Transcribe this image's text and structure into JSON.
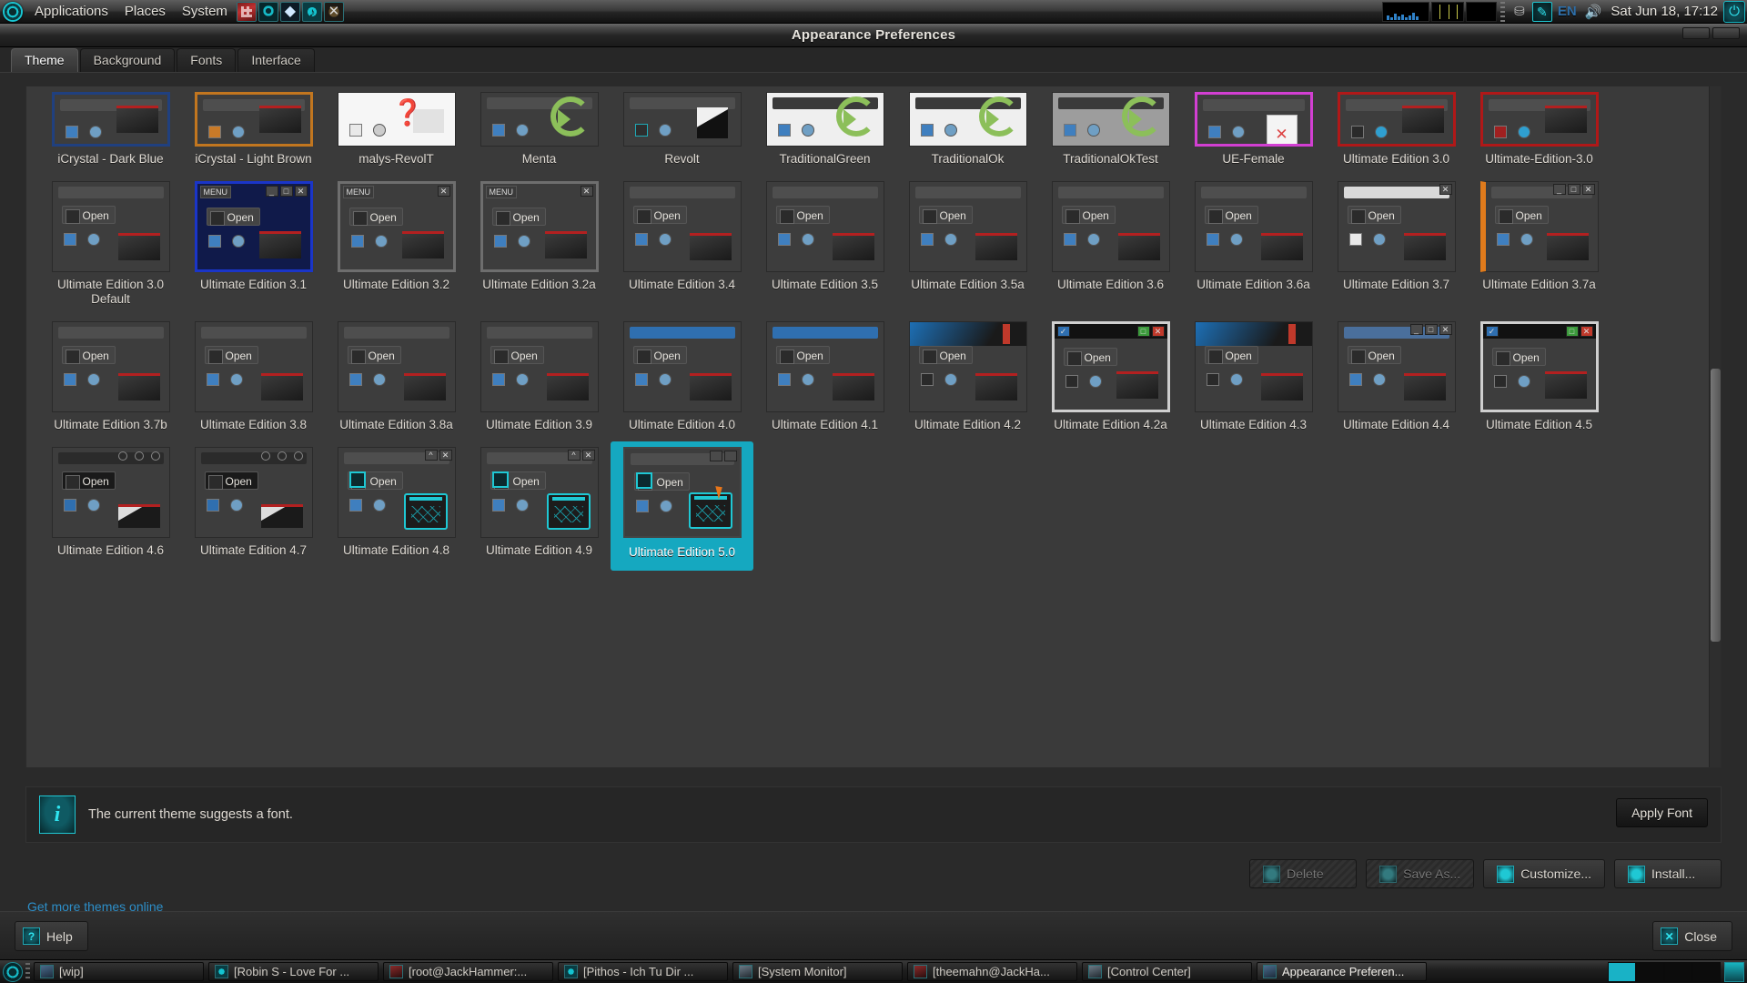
{
  "top_panel": {
    "logo_icon": "gnome-foot-icon",
    "menus": [
      "Applications",
      "Places",
      "System"
    ],
    "launchers": [
      {
        "name": "keyboard-shortcuts-icon"
      },
      {
        "name": "ultimate-edition-icon"
      },
      {
        "name": "kodi-icon"
      },
      {
        "name": "music-player-icon"
      },
      {
        "name": "xterm-icon"
      }
    ],
    "tray": {
      "monitor_icon": "system-monitor-applet",
      "drive_icon": "disk-activity-icon",
      "pen_icon": "screenshot-pen-icon",
      "language": "EN",
      "volume_icon": "volume-icon",
      "clock": "Sat Jun 18, 17:12",
      "power_icon": "power-button-icon"
    }
  },
  "window": {
    "title": "Appearance Preferences",
    "tabs": [
      {
        "label": "Theme",
        "active": true
      },
      {
        "label": "Background",
        "active": false
      },
      {
        "label": "Fonts",
        "active": false
      },
      {
        "label": "Interface",
        "active": false
      }
    ]
  },
  "themes": {
    "rows": [
      [
        {
          "label": "iCrystal - Dark Blue",
          "style": "icrystal-blue",
          "clipped": true
        },
        {
          "label": "iCrystal - Light Brown",
          "style": "icrystal-brown",
          "clipped": true
        },
        {
          "label": "malys-RevolT",
          "style": "light-doc",
          "clipped": true
        },
        {
          "label": "Menta",
          "style": "dark-circle",
          "clipped": true
        },
        {
          "label": "Revolt",
          "style": "dark-folder",
          "clipped": true
        },
        {
          "label": "TraditionalGreen",
          "style": "light-circle",
          "clipped": true
        },
        {
          "label": "TraditionalOk",
          "style": "light-circle",
          "clipped": true
        },
        {
          "label": "TraditionalOkTest",
          "style": "grey-circle",
          "clipped": true
        },
        {
          "label": "UE-Female",
          "style": "magenta-doc",
          "clipped": true
        },
        {
          "label": "Ultimate Edition 3.0",
          "style": "red-folder",
          "clipped": true
        },
        {
          "label": "Ultimate-Edition-3.0",
          "style": "red-folder2",
          "clipped": true
        }
      ],
      [
        {
          "label": "Ultimate Edition 3.0 Default",
          "style": "plain-dark"
        },
        {
          "label": "Ultimate Edition 3.1",
          "style": "blue-glow"
        },
        {
          "label": "Ultimate Edition 3.2",
          "style": "menu-dark"
        },
        {
          "label": "Ultimate Edition 3.2a",
          "style": "menu-dark2"
        },
        {
          "label": "Ultimate Edition 3.4",
          "style": "plain-dark"
        },
        {
          "label": "Ultimate Edition 3.5",
          "style": "plain-dark"
        },
        {
          "label": "Ultimate Edition 3.5a",
          "style": "plain-dark"
        },
        {
          "label": "Ultimate Edition 3.6",
          "style": "plain-dark"
        },
        {
          "label": "Ultimate Edition 3.6a",
          "style": "plain-dark"
        },
        {
          "label": "Ultimate Edition 3.7",
          "style": "grey-bar"
        },
        {
          "label": "Ultimate Edition 3.7a",
          "style": "orange-edge"
        }
      ],
      [
        {
          "label": "Ultimate Edition 3.7b",
          "style": "plain-dark"
        },
        {
          "label": "Ultimate Edition 3.8",
          "style": "plain-dark"
        },
        {
          "label": "Ultimate Edition 3.8a",
          "style": "plain-dark"
        },
        {
          "label": "Ultimate Edition 3.9",
          "style": "plain-dark"
        },
        {
          "label": "Ultimate Edition 4.0",
          "style": "blue-title"
        },
        {
          "label": "Ultimate Edition 4.1",
          "style": "blue-title"
        },
        {
          "label": "Ultimate Edition 4.2",
          "style": "wave-dark"
        },
        {
          "label": "Ultimate Edition 4.2a",
          "style": "colored-btns"
        },
        {
          "label": "Ultimate Edition 4.3",
          "style": "wave-dark"
        },
        {
          "label": "Ultimate Edition 4.4",
          "style": "blue-bar"
        },
        {
          "label": "Ultimate Edition 4.5",
          "style": "colored-btns2"
        }
      ],
      [
        {
          "label": "Ultimate Edition 4.6",
          "style": "black-dots"
        },
        {
          "label": "Ultimate Edition 4.7",
          "style": "black-dots"
        },
        {
          "label": "Ultimate Edition 4.8",
          "style": "teal-net"
        },
        {
          "label": "Ultimate Edition 4.9",
          "style": "teal-net"
        },
        {
          "label": "Ultimate Edition 5.0",
          "style": "teal-net-selected",
          "selected": true
        }
      ]
    ]
  },
  "font_notice": {
    "icon": "info-icon",
    "text": "The current theme suggests a font.",
    "apply_label": "Apply Font"
  },
  "actions": [
    {
      "label": "Delete",
      "icon": "delete-icon",
      "disabled": true
    },
    {
      "label": "Save As...",
      "icon": "save-icon",
      "disabled": true
    },
    {
      "label": "Customize...",
      "icon": "customize-icon",
      "disabled": false
    },
    {
      "label": "Install...",
      "icon": "install-icon",
      "disabled": false
    }
  ],
  "more_themes_link": "Get more themes online",
  "footer": {
    "help_label": "Help",
    "help_icon": "help-icon",
    "close_label": "Close",
    "close_icon": "close-icon"
  },
  "taskbar": {
    "show_desktop_icon": "show-desktop-icon",
    "items": [
      {
        "label": "[wip]",
        "icon": "window-icon",
        "active": false
      },
      {
        "label": "[Robin S - Love For ...",
        "icon": "music-icon",
        "active": false
      },
      {
        "label": "[root@JackHammer:...",
        "icon": "terminal-icon",
        "active": false
      },
      {
        "label": "[Pithos - Ich Tu Dir ...",
        "icon": "pithos-icon",
        "active": false
      },
      {
        "label": "[System Monitor]",
        "icon": "monitor-icon",
        "active": false
      },
      {
        "label": "[theemahn@JackHa...",
        "icon": "terminal-icon",
        "active": false
      },
      {
        "label": "[Control Center]",
        "icon": "control-icon",
        "active": false
      },
      {
        "label": "Appearance Preferen...",
        "icon": "appearance-icon",
        "active": true
      }
    ],
    "workspaces": [
      {
        "active": true
      },
      {
        "active": false
      },
      {
        "active": false
      },
      {
        "active": false
      }
    ],
    "trash_icon": "trash-icon"
  },
  "colors": {
    "accent": "#15a8c0",
    "link": "#2d8fc9",
    "panel_bg": "#3a3a3a",
    "window_bg": "#2a2a2a"
  }
}
